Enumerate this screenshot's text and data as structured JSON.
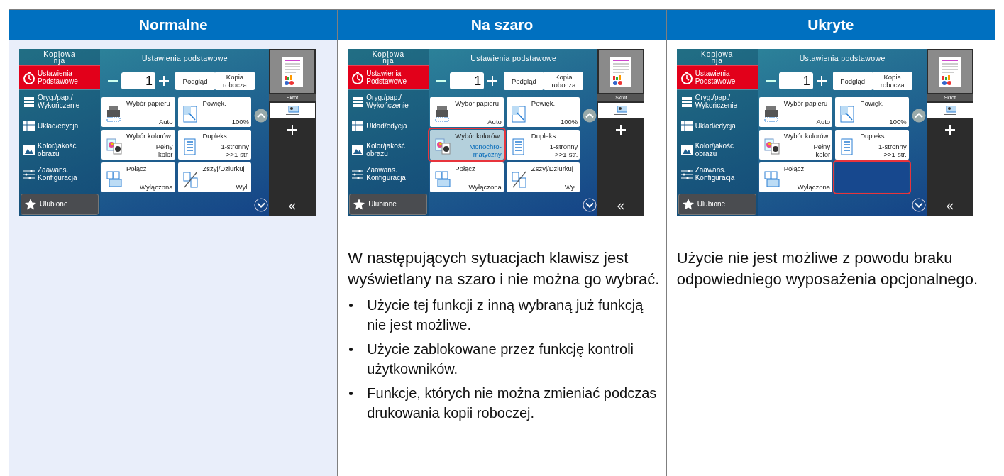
{
  "columns": [
    {
      "header": "Normalne",
      "shaded": true,
      "screen": {
        "app_title_lines": [
          "Kopiowa",
          "nja"
        ],
        "title": "Ustawienia podstawowe",
        "copies": "1",
        "buttons": [
          [
            "Podgląd"
          ],
          [
            "Kopia",
            "robocza"
          ]
        ],
        "menu": [
          {
            "kind": "timer",
            "lines": [
              "Ustawienia",
              "Podstawowe"
            ],
            "selected": true
          },
          {
            "kind": "paper",
            "lines": [
              "Oryg./pap./",
              "Wykończenie"
            ],
            "selected": false
          },
          {
            "kind": "layout",
            "lines": [
              "Układ/edycja"
            ],
            "selected": false
          },
          {
            "kind": "image",
            "lines": [
              "Kolor/jakość",
              "obrazu"
            ],
            "selected": false
          },
          {
            "kind": "sliders",
            "lines": [
              "Zaawans.",
              "Konfiguracja"
            ],
            "selected": false
          }
        ],
        "favorites": "Ulubione",
        "shortcut_label": "Skrót",
        "tiles": [
          {
            "kind": "paper",
            "title": "Wybór papieru",
            "value": [
              "Auto"
            ],
            "disabled": false,
            "hidden": false,
            "highlighted": false
          },
          {
            "kind": "zoom",
            "title": "Powięk.",
            "value": [
              "100%"
            ],
            "disabled": false,
            "hidden": false,
            "highlighted": false
          },
          {
            "kind": "color",
            "title": "Wybór kolorów",
            "value": [
              "Pełny",
              "kolor"
            ],
            "disabled": false,
            "hidden": false,
            "highlighted": false
          },
          {
            "kind": "duplex",
            "title": "Dupleks",
            "value": [
              "1-stronny",
              ">>1-str."
            ],
            "disabled": false,
            "hidden": false,
            "highlighted": false
          },
          {
            "kind": "combine",
            "title": "Połącz",
            "value": [
              "Wyłączona"
            ],
            "disabled": false,
            "hidden": false,
            "highlighted": false
          },
          {
            "kind": "staple",
            "title": "Zszyj/Dziurkuj",
            "value": [
              "Wył."
            ],
            "disabled": false,
            "hidden": false,
            "highlighted": false
          }
        ]
      }
    },
    {
      "header": "Na szaro",
      "shaded": false,
      "screen": {
        "app_title_lines": [
          "Kopiowa",
          "nja"
        ],
        "title": "Ustawienia podstawowe",
        "copies": "1",
        "buttons": [
          [
            "Podgląd"
          ],
          [
            "Kopia",
            "robocza"
          ]
        ],
        "menu": [
          {
            "kind": "timer",
            "lines": [
              "Ustawienia",
              "Podstawowe"
            ],
            "selected": true
          },
          {
            "kind": "paper",
            "lines": [
              "Oryg./pap./",
              "Wykończenie"
            ],
            "selected": false
          },
          {
            "kind": "layout",
            "lines": [
              "Układ/edycja"
            ],
            "selected": false
          },
          {
            "kind": "image",
            "lines": [
              "Kolor/jakość",
              "obrazu"
            ],
            "selected": false
          },
          {
            "kind": "sliders",
            "lines": [
              "Zaawans.",
              "Konfiguracja"
            ],
            "selected": false
          }
        ],
        "favorites": "Ulubione",
        "shortcut_label": "Skrót",
        "tiles": [
          {
            "kind": "paper",
            "title": "Wybór papieru",
            "value": [
              "Auto"
            ],
            "disabled": false,
            "hidden": false,
            "highlighted": false
          },
          {
            "kind": "zoom",
            "title": "Powięk.",
            "value": [
              "100%"
            ],
            "disabled": false,
            "hidden": false,
            "highlighted": false
          },
          {
            "kind": "color",
            "title": "Wybór kolorów",
            "value": [
              "Monochro-",
              "matyczny"
            ],
            "disabled": true,
            "hidden": false,
            "highlighted": true
          },
          {
            "kind": "duplex",
            "title": "Dupleks",
            "value": [
              "1-stronny",
              ">>1-str."
            ],
            "disabled": false,
            "hidden": false,
            "highlighted": false
          },
          {
            "kind": "combine",
            "title": "Połącz",
            "value": [
              "Wyłączona"
            ],
            "disabled": false,
            "hidden": false,
            "highlighted": false
          },
          {
            "kind": "staple",
            "title": "Zszyj/Dziurkuj",
            "value": [
              "Wył."
            ],
            "disabled": false,
            "hidden": false,
            "highlighted": false
          }
        ]
      },
      "paragraph": "W następujących sytuacjach klawisz jest wyświetlany na szaro i nie można go wybrać.",
      "bullets": [
        "Użycie tej funkcji z inną wybraną już funkcją nie jest możliwe.",
        "Użycie zablokowane przez funkcję kontroli użytkowników.",
        "Funkcje, których nie można zmieniać podczas drukowania kopii roboczej."
      ]
    },
    {
      "header": "Ukryte",
      "shaded": false,
      "screen": {
        "app_title_lines": [
          "Kopiowa",
          "nja"
        ],
        "title": "Ustawienia podstawowe",
        "copies": "1",
        "buttons": [
          [
            "Podgląd"
          ],
          [
            "Kopia",
            "robocza"
          ]
        ],
        "menu": [
          {
            "kind": "timer",
            "lines": [
              "Ustawienia",
              "Podstawowe"
            ],
            "selected": true
          },
          {
            "kind": "paper",
            "lines": [
              "Oryg./pap./",
              "Wykończenie"
            ],
            "selected": false
          },
          {
            "kind": "layout",
            "lines": [
              "Układ/edycja"
            ],
            "selected": false
          },
          {
            "kind": "image",
            "lines": [
              "Kolor/jakość",
              "obrazu"
            ],
            "selected": false
          },
          {
            "kind": "sliders",
            "lines": [
              "Zaawans.",
              "Konfiguracja"
            ],
            "selected": false
          }
        ],
        "favorites": "Ulubione",
        "shortcut_label": "Skrót",
        "tiles": [
          {
            "kind": "paper",
            "title": "Wybór papieru",
            "value": [
              "Auto"
            ],
            "disabled": false,
            "hidden": false,
            "highlighted": false
          },
          {
            "kind": "zoom",
            "title": "Powięk.",
            "value": [
              "100%"
            ],
            "disabled": false,
            "hidden": false,
            "highlighted": false
          },
          {
            "kind": "color",
            "title": "Wybór kolorów",
            "value": [
              "Pełny",
              "kolor"
            ],
            "disabled": false,
            "hidden": false,
            "highlighted": false
          },
          {
            "kind": "duplex",
            "title": "Dupleks",
            "value": [
              "1-stronny",
              ">>1-str."
            ],
            "disabled": false,
            "hidden": false,
            "highlighted": false
          },
          {
            "kind": "combine",
            "title": "Połącz",
            "value": [
              "Wyłączona"
            ],
            "disabled": false,
            "hidden": false,
            "highlighted": false
          },
          {
            "hidden": true,
            "highlighted": true
          }
        ]
      },
      "paragraph": "Użycie nie jest możliwe z powodu braku odpowiedniego wyposażenia opcjonalnego."
    }
  ]
}
